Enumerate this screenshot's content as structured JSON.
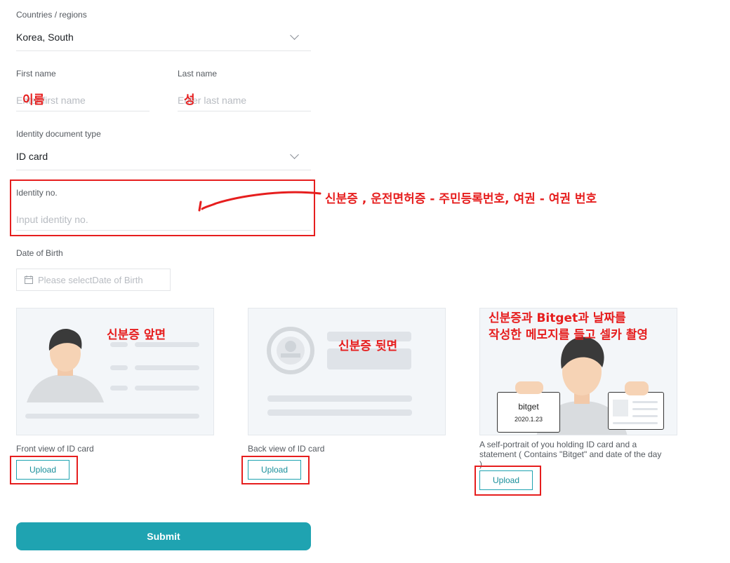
{
  "country": {
    "label": "Countries / regions",
    "value": "Korea, South"
  },
  "first_name": {
    "label": "First name",
    "placeholder": "Enter first name"
  },
  "last_name": {
    "label": "Last name",
    "placeholder": "Enter last name"
  },
  "doc_type": {
    "label": "Identity document type",
    "value": "ID card"
  },
  "identity": {
    "label": "Identity no.",
    "placeholder": "Input identity no."
  },
  "dob": {
    "label": "Date of Birth",
    "placeholder": "Please selectDate of Birth"
  },
  "uploads": {
    "front": {
      "caption": "Front view of ID card",
      "button": "Upload"
    },
    "back": {
      "caption": "Back view of ID card",
      "button": "Upload"
    },
    "selfie": {
      "caption": "A self-portrait of you holding ID card and a statement ( Contains \"Bitget\" and date of the day )",
      "button": "Upload",
      "note_line1": "bitget",
      "note_line2": "2020.1.23"
    }
  },
  "submit_label": "Submit",
  "annotations": {
    "first_name": "이름",
    "last_name": "성",
    "identity": "신분증 , 운전면허증 - 주민등록번호, 여권 - 여권 번호",
    "front": "신분증 앞면",
    "back": "신분증 뒷면",
    "selfie_line1": "신분증과 Bitget과 날짜를",
    "selfie_line2": "작성한 메모지를 들고 셀카 촬영"
  },
  "colors": {
    "accent": "#1fa3b1",
    "annotation": "#e61e1e"
  }
}
